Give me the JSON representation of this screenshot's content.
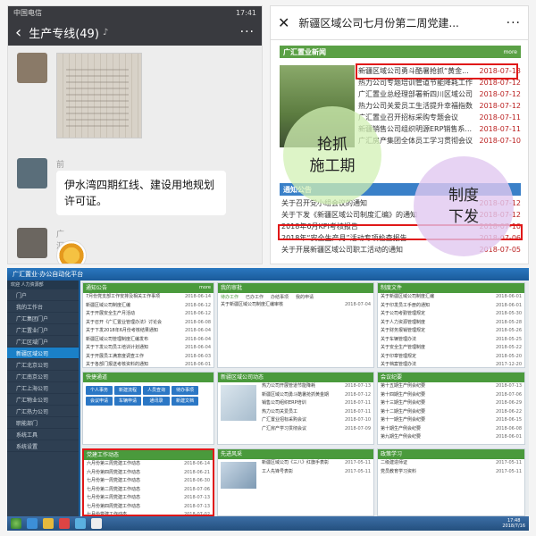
{
  "chat": {
    "carrier": "中国电信",
    "time": "17:41",
    "title": "生产专线(49)",
    "messages": [
      {
        "sender": "",
        "type": "image"
      },
      {
        "sender": "前阳-赵鑫",
        "text": "伊水湾四期红线、建设用地规划许可证。"
      },
      {
        "sender": "广汇许晓琴",
        "type": "sticker"
      }
    ]
  },
  "news": {
    "title": "新疆区域公司七月份第二周党建...",
    "section1": "广汇置业新闻",
    "more": "more",
    "items": [
      {
        "text": "新疆区域公司勇斗酷暑抢抓“黄金...",
        "date": "2018-07-13"
      },
      {
        "text": "热力公司专题培训管道节能降耗工作",
        "date": "2018-07-12"
      },
      {
        "text": "广汇置业总经理部署新四川区域公司",
        "date": "2018-07-12"
      },
      {
        "text": "热力公司关爱员工生活提升幸福指数",
        "date": "2018-07-12"
      },
      {
        "text": "广汇置业召开招标采购专题会议",
        "date": "2018-07-11"
      },
      {
        "text": "新疆销售公司组织明源ERP销售系...",
        "date": "2018-07-11"
      },
      {
        "text": "广汇房产集团全体员工学习贯彻会议",
        "date": "2018-07-10"
      }
    ],
    "section2": "通知公告",
    "notices": [
      {
        "text": "关于召开党小组会议的通知",
        "date": "2018-07-12"
      },
      {
        "text": "关于下发《新疆区域公司制度汇编》的通知",
        "date": "2018-07-12"
      },
      {
        "text": "2018年6月KPI考核报告",
        "date": "2018-07-10"
      },
      {
        "text": "2018年“安全生产月”活动专项检查报告",
        "date": "2018-07-06"
      },
      {
        "text": "关于开展新疆区域公司职工活动的通知",
        "date": "2018-07-05"
      }
    ],
    "overlay1": "抢抓\n施工期",
    "overlay2": "制度\n下发"
  },
  "desktop": {
    "header": "广汇置业·办公自动化平台",
    "user": "欢迎 人力资源部",
    "sidebar": [
      "门户",
      "我的工作台",
      "广汇集团门户",
      "广汇置业门户",
      "广汇区域门户",
      "新疆区域公司",
      "广汇北京公司",
      "广汇南京公司",
      "广汇上海公司",
      "广汇物业公司",
      "广汇热力公司",
      "职能部门",
      "系统工具",
      "系统设置"
    ],
    "panels": {
      "notice": {
        "title": "通知公告",
        "rows": [
          {
            "t": "7月份党支部工作安排及相关工作事项",
            "d": "2018-06-14"
          },
          {
            "t": "新疆区域公司制度汇编",
            "d": "2018-06-12"
          },
          {
            "t": "关于开展安全生产月活动",
            "d": "2018-06-12"
          },
          {
            "t": "关于召开《广汇置业管理办法》讨论会",
            "d": "2018-06-08"
          },
          {
            "t": "关于下发2018年6月份考核结果通知",
            "d": "2018-06-04"
          },
          {
            "t": "新疆区域公司管理制度汇编发布",
            "d": "2018-06-04"
          },
          {
            "t": "关于下发公司员工培训计划通知",
            "d": "2018-06-04"
          },
          {
            "t": "关于开展员工满意度调查工作",
            "d": "2018-06-03"
          },
          {
            "t": "关于各部门报送考核资料的通知",
            "d": "2018-06-01"
          }
        ]
      },
      "review": {
        "title": "我的审批",
        "rows": [
          {
            "t": "关于新疆区域公司制度汇编审核",
            "d": "2018-07-04"
          }
        ]
      },
      "quick": {
        "title": "快捷通道",
        "buttons": [
          "个人事务",
          "新建流程",
          "人员查询",
          "待办事项",
          "会议申请",
          "车辆申请",
          "通讯录",
          "新建文档"
        ]
      },
      "build": {
        "title": "新疆区域公司动态",
        "rows": [
          {
            "t": "热力公司开展管道节能降耗",
            "d": "2018-07-13"
          },
          {
            "t": "新疆区域公司勇斗酷暑抢抓黄金期",
            "d": "2018-07-12"
          },
          {
            "t": "销售公司组织ERP培训",
            "d": "2018-07-11"
          },
          {
            "t": "热力公司关爱员工",
            "d": "2018-07-11"
          },
          {
            "t": "广汇置业招标采购会议",
            "d": "2018-07-10"
          },
          {
            "t": "广汇房产学习贯彻会议",
            "d": "2018-07-09"
          }
        ]
      },
      "party": {
        "title": "党建工作动态",
        "rows": [
          {
            "t": "六月份第三周党建工作动态",
            "d": "2018-06-14"
          },
          {
            "t": "六月份第四周党建工作动态",
            "d": "2018-06-21"
          },
          {
            "t": "七月份第一周党建工作动态",
            "d": "2018-06-30"
          },
          {
            "t": "七月份第二周党建工作动态",
            "d": "2018-07-06"
          },
          {
            "t": "七月份第三周党建工作动态",
            "d": "2018-07-13"
          },
          {
            "t": "七月份第四周党建工作动态",
            "d": "2018-07-13"
          },
          {
            "t": "七月份党建工作动态",
            "d": "2018-07-02"
          }
        ]
      },
      "kpi": {
        "title": "先进风采",
        "rows": [
          {
            "t": "新疆区域公司《三八》红旗手表彰",
            "d": "2017-05-11"
          },
          {
            "t": "工人先锋号表彰",
            "d": "2017-05-11"
          }
        ]
      },
      "right1": {
        "title": "制度文件",
        "rows": [
          {
            "t": "关于新疆区域公司制度汇编",
            "d": "2018-06-01"
          },
          {
            "t": "关于印发员工手册的通知",
            "d": "2018-06-01"
          },
          {
            "t": "关于公司考勤管理规定",
            "d": "2018-05-30"
          },
          {
            "t": "关于人力资源管理制度",
            "d": "2018-05-28"
          },
          {
            "t": "关于财务报销管理规定",
            "d": "2018-05-26"
          },
          {
            "t": "关于车辆管理办法",
            "d": "2018-05-25"
          },
          {
            "t": "关于安全生产管理制度",
            "d": "2018-05-22"
          },
          {
            "t": "关于印章管理规定",
            "d": "2018-05-20"
          },
          {
            "t": "关于档案管理办法",
            "d": "2017-12-20"
          },
          {
            "t": "关于会议管理规定",
            "d": "2017-12-14"
          }
        ]
      },
      "right2": {
        "title": "会议纪要",
        "rows": [
          {
            "t": "第十五期生产例会纪要",
            "d": "2018-07-13"
          },
          {
            "t": "第十四期生产例会纪要",
            "d": "2018-07-06"
          },
          {
            "t": "第十三期生产例会纪要",
            "d": "2018-06-29"
          },
          {
            "t": "第十二期生产例会纪要",
            "d": "2018-06-22"
          },
          {
            "t": "第十一期生产例会纪要",
            "d": "2018-06-15"
          },
          {
            "t": "第十期生产例会纪要",
            "d": "2018-06-08"
          },
          {
            "t": "第九期生产例会纪要",
            "d": "2018-06-01"
          }
        ]
      },
      "right3": {
        "title": "政策学习",
        "rows": [
          {
            "t": "二级建造师证",
            "d": "2017-05-11"
          },
          {
            "t": "党员教育学习资料",
            "d": "2017-05-11"
          }
        ]
      }
    },
    "tabs": [
      "待办工作",
      "已办工作",
      "办结事项",
      "我的申请"
    ],
    "clock_time": "17:48",
    "clock_date": "2018/7/16"
  },
  "colors": {
    "accent_green": "#4a9a3c",
    "highlight_red": "#e01818",
    "taskbar": "#24507e"
  }
}
